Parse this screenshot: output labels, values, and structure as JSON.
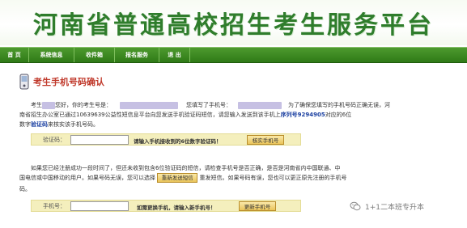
{
  "banner": {
    "title": "河南省普通高校招生考生服务平台"
  },
  "nav": {
    "items": [
      "首  页",
      "系统信息",
      "收件箱",
      "报名服务",
      "退  出"
    ]
  },
  "section": {
    "title": "考生手机号码确认"
  },
  "intro": {
    "t1": "考生",
    "t2": "您好，你的考生号是：",
    "t3": "您填写了手机号：",
    "t4": "为了确保您填写的手机号码正确无误，河",
    "t5": "南省招生办公室已通过10639639公益性短信息平台向您发送手机验证码短信，请您输入发送到该手机上",
    "t6": "序列号9294905",
    "t7": "对应的6位",
    "t8": "数字",
    "t9": "验证码",
    "t10": "来核实该手机号码。"
  },
  "verify": {
    "label": "验证码：",
    "hint": "请输入手机接收到的6位数字验证码！",
    "button": "核实手机号"
  },
  "notice": {
    "l1": "如果您已经注册成功一段时间了，但还未收到包含6位验证码的短信，请检查手机号是否正确，是否是河南省内中国联通、中",
    "l2a": "国电信或中国移动的用户。如果号码无误，您可以选择",
    "resend": "重新发送短信",
    "l2b": "重发短信。如果号码有误，您也可以更正原先注册的手机号",
    "l3": "码。"
  },
  "change": {
    "label": "手机号：",
    "hint": "如需更换手机，请输入新手机号！",
    "button": "更新手机号"
  },
  "watermark": {
    "text": "1+1二本班专升本"
  },
  "colors": {
    "brand_green": "#2f7d2c",
    "heading_red": "#c0392b",
    "row_yellow": "#f4efbd"
  }
}
